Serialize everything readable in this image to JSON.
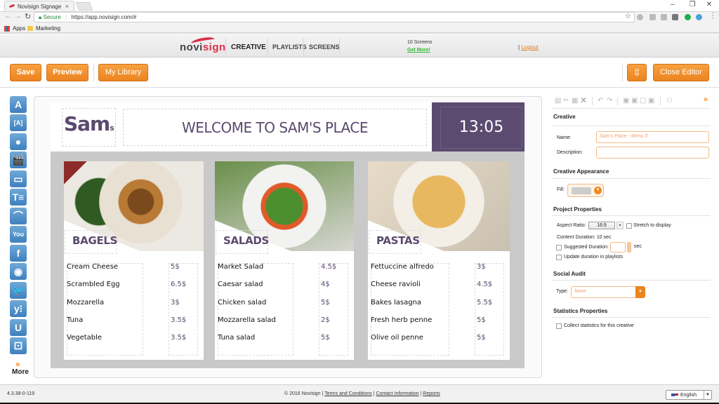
{
  "browser": {
    "tab_title": "Novisign Signage",
    "secure_label": "Secure",
    "url": "https://app.novisign.com/#",
    "bookmarks": [
      "Apps",
      "Marketing"
    ]
  },
  "app_header": {
    "logo_prefix": "novi",
    "logo_suffix": "sign",
    "nav": [
      "CREATIVE",
      "PLAYLISTS",
      "SCREENS"
    ],
    "screens_count": "10 Screens",
    "get_more": "Get More!",
    "logout_sep": "|",
    "logout": "Logout"
  },
  "actions": {
    "save": "Save",
    "preview": "Preview",
    "my_library": "My Library",
    "resize": "⇳",
    "close_editor": "Close Editor"
  },
  "tools": [
    {
      "name": "text-tool",
      "glyph": "A"
    },
    {
      "name": "text-box-tool",
      "glyph": "[A]"
    },
    {
      "name": "camera-tool",
      "glyph": "●"
    },
    {
      "name": "video-tool",
      "glyph": "🎬"
    },
    {
      "name": "gallery-tool",
      "glyph": "▭"
    },
    {
      "name": "ticker-tool",
      "glyph": "T≡"
    },
    {
      "name": "rss-tool",
      "glyph": "⌒"
    },
    {
      "name": "youtube-tool",
      "glyph": "You Tube"
    },
    {
      "name": "facebook-tool",
      "glyph": "f"
    },
    {
      "name": "instagram-tool",
      "glyph": "◉"
    },
    {
      "name": "twitter-tool",
      "glyph": "🐦"
    },
    {
      "name": "yammer-tool",
      "glyph": "y⁝"
    },
    {
      "name": "ustream-tool",
      "glyph": "U"
    },
    {
      "name": "widget-tool",
      "glyph": "⚀"
    }
  ],
  "more": {
    "chevron": "»",
    "label": "More"
  },
  "creative": {
    "logo": "Sam",
    "logo_small": "s",
    "welcome": "WELCOME TO SAM'S PLACE",
    "clock": "13:05",
    "sections": [
      {
        "title": "BAGELS",
        "items": [
          {
            "name": "Cream Cheese",
            "price": "5$"
          },
          {
            "name": "Scrambled Egg",
            "price": "6.5$"
          },
          {
            "name": "Mozzarella",
            "price": "3$"
          },
          {
            "name": "Tuna",
            "price": "3.5$"
          },
          {
            "name": "Vegetable",
            "price": "3.5$"
          }
        ]
      },
      {
        "title": "SALADS",
        "items": [
          {
            "name": "Market Salad",
            "price": "4.5$"
          },
          {
            "name": "Caesar salad",
            "price": "4$"
          },
          {
            "name": "Chicken salad",
            "price": "5$"
          },
          {
            "name": "Mozzarella salad",
            "price": "2$"
          },
          {
            "name": "Tuna salad",
            "price": "5$"
          }
        ]
      },
      {
        "title": "PASTAS",
        "items": [
          {
            "name": "Fettuccine alfredo",
            "price": "3$"
          },
          {
            "name": "Cheese ravioli",
            "price": "4.5$"
          },
          {
            "name": "Bakes lasagna",
            "price": "5.5$"
          },
          {
            "name": "Fresh herb penne",
            "price": "5$"
          },
          {
            "name": "Olive oil penne",
            "price": "5$"
          }
        ]
      }
    ]
  },
  "properties": {
    "expand": "»",
    "creative_hdr": "Creative",
    "name_label": "Name:",
    "name_value": "Sam's Place - Menu 3",
    "description_label": "Description:",
    "description_value": "",
    "appearance_hdr": "Creative Appearance",
    "fill_label": "Fill:",
    "fill_color": "#cccccc",
    "project_hdr": "Project Properties",
    "aspect_label": "Aspect Ratio:",
    "aspect_value": "16:9",
    "stretch_label": "Stretch to display",
    "content_duration_label": "Content Duration:",
    "content_duration_value": "10 sec",
    "suggested_label": "Suggested Duration:",
    "suggested_value": "",
    "sec": "sec",
    "update_label": "Update duration in playlists",
    "social_hdr": "Social Audit",
    "type_label": "Type:",
    "type_value": "None",
    "stats_hdr": "Statistics Properties",
    "collect_label": "Collect statistics for this creative"
  },
  "footer": {
    "version": "4.3.38-0-119",
    "copyright": "© 2016 Novisign |",
    "terms": "Terms and Conditions",
    "contact": "Contact Information",
    "reports": "Reports",
    "language": "English"
  },
  "colors": {
    "accent": "#ec8420",
    "brand_purple": "#5b4b70",
    "tool_blue": "#4a8bc6"
  }
}
